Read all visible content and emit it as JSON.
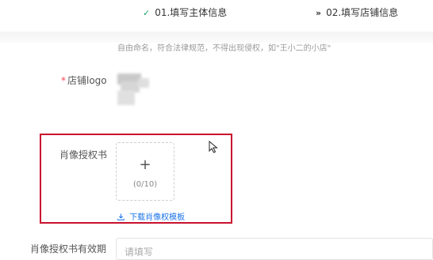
{
  "steps": [
    {
      "label": "01.填写主体信息",
      "state": "done",
      "icon": "check-icon"
    },
    {
      "label": "02.填写店铺信息",
      "state": "active",
      "icon": "double-chevron-right-icon"
    }
  ],
  "form": {
    "name_hint": "自由命名，符合法律规范，不得出现侵权，如\"王小二的小店\"",
    "logo_label": "店铺logo",
    "logo_required_mark": "*",
    "portrait_label": "肖像授权书",
    "upload_plus": "+",
    "upload_count": "(0/10)",
    "download_link": "下载肖像权模板",
    "validity_label": "肖像授权书有效期",
    "validity_placeholder": "请填写"
  },
  "colors": {
    "done_check": "#25a36f",
    "required": "#f5475a",
    "link": "#1a73e8",
    "highlight_box": "#c8102e"
  }
}
